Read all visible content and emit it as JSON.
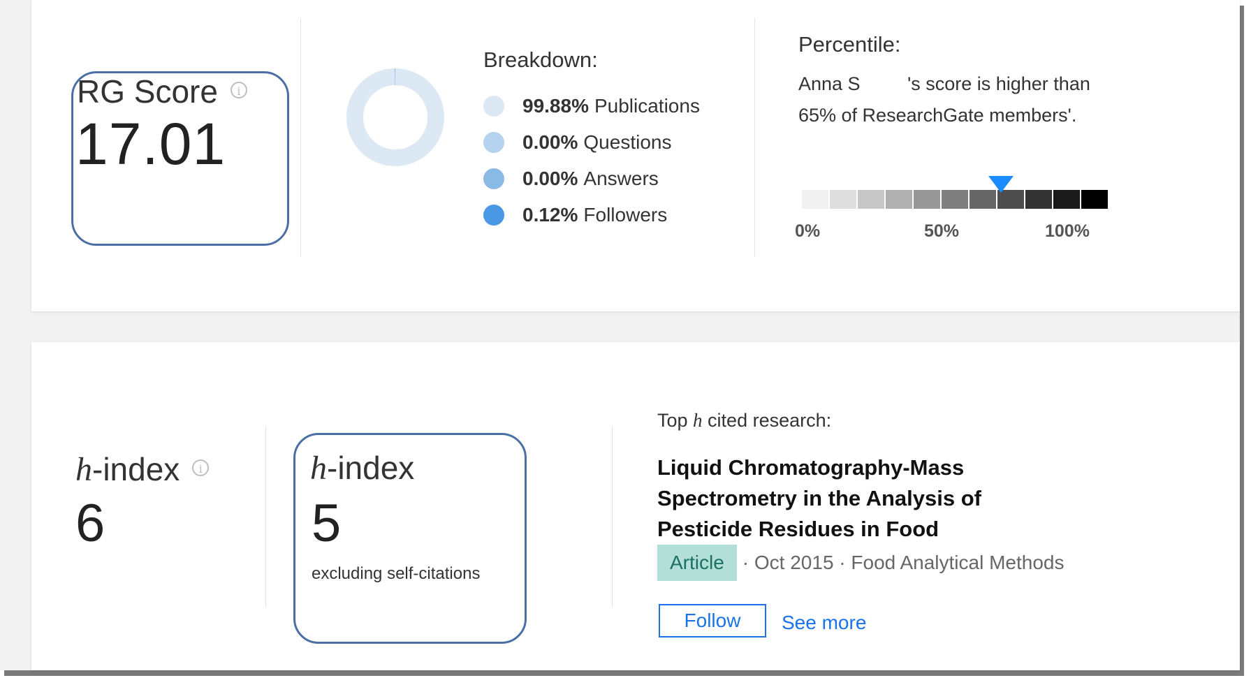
{
  "rg_score": {
    "label": "RG Score",
    "info_icon": "info-icon",
    "value": "17.01"
  },
  "breakdown": {
    "title": "Breakdown:",
    "items": [
      {
        "percent": "99.88%",
        "label": "Publications",
        "color": "#dce9f5"
      },
      {
        "percent": "0.00%",
        "label": "Questions",
        "color": "#b5d2ee"
      },
      {
        "percent": "0.00%",
        "label": "Answers",
        "color": "#8bb9e6"
      },
      {
        "percent": "0.12%",
        "label": "Followers",
        "color": "#4a97e6"
      }
    ],
    "donut_fractions": [
      0.9988,
      0.0,
      0.0,
      0.0012
    ]
  },
  "percentile": {
    "title": "Percentile:",
    "text": "Anna S     's score is higher than 65% of ResearchGate members'.",
    "value_percent": 65,
    "ticks": [
      "0%",
      "50%",
      "100%"
    ],
    "segment_colors": [
      "#f0f0f0",
      "#dedede",
      "#c8c8c8",
      "#b0b0b0",
      "#979797",
      "#7f7f7f",
      "#666666",
      "#4d4d4d",
      "#333333",
      "#1a1a1a",
      "#000000"
    ],
    "marker_color": "#1a8cff"
  },
  "h_index": {
    "label_italic": "h",
    "label_rest": "-index",
    "value": "6",
    "info_icon": "info-icon"
  },
  "h_index_excl": {
    "label_italic": "h",
    "label_rest": "-index",
    "value": "5",
    "note": "excluding self-citations"
  },
  "top_cited": {
    "title_prefix": "Top ",
    "title_italic": "h",
    "title_suffix": " cited research:",
    "publication_title": "Liquid Chromatography-Mass Spectrometry in the Analysis of Pesticide Residues in Food",
    "type_badge": "Article",
    "meta": "· Oct 2015 · Food Analytical Methods",
    "follow_label": "Follow",
    "see_more_label": "See more"
  }
}
